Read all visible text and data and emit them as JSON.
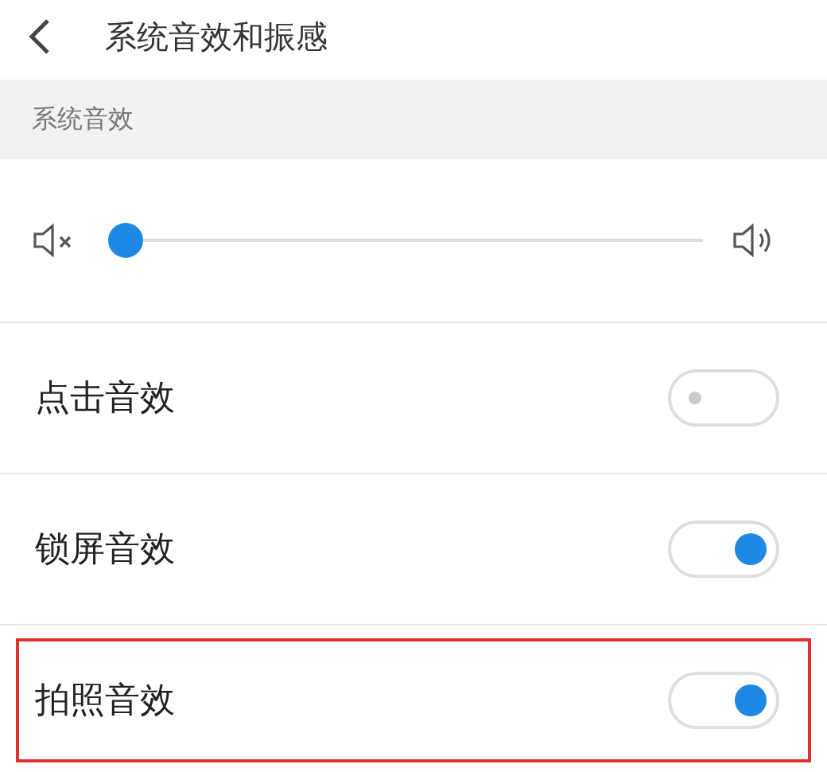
{
  "header": {
    "title": "系统音效和振感"
  },
  "section": {
    "title": "系统音效"
  },
  "volume": {
    "level": 0.0
  },
  "settings": [
    {
      "label": "点击音效",
      "on": false,
      "highlighted": false
    },
    {
      "label": "锁屏音效",
      "on": true,
      "highlighted": false
    },
    {
      "label": "拍照音效",
      "on": true,
      "highlighted": true
    }
  ]
}
